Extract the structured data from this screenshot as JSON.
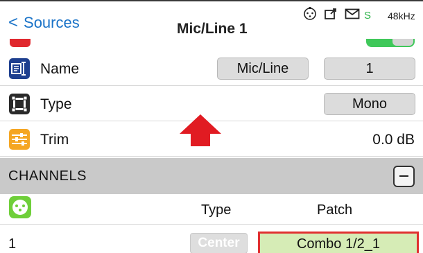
{
  "header": {
    "back_label": "Sources",
    "title": "Mic/Line 1",
    "status_letter": "S",
    "sample_rate": "48kHz"
  },
  "rows": {
    "name": {
      "label": "Name",
      "value": "Mic/Line",
      "number": "1"
    },
    "type": {
      "label": "Type",
      "value": "Mono"
    },
    "trim": {
      "label": "Trim",
      "value": "0.0 dB"
    }
  },
  "channels": {
    "section_label": "CHANNELS",
    "col_type": "Type",
    "col_patch": "Patch",
    "rows": [
      {
        "number": "1",
        "type": "Center",
        "patch": "Combo 1/2_1"
      }
    ]
  },
  "colors": {
    "accent": "#1a73c8",
    "name_icon": "#1e3f8f",
    "type_icon": "#2a2a2a",
    "trim_icon": "#f5a623",
    "xlr_icon": "#6fcf3a",
    "highlight": "#e03030",
    "arrow": "#e11b22"
  }
}
